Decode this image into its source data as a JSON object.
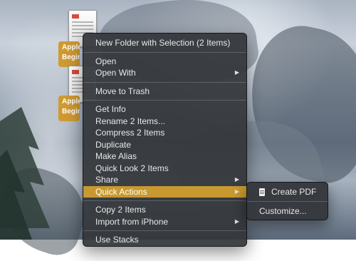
{
  "desktop": {
    "files": [
      {
        "label_line1": "Apple",
        "label_line2": "Begin"
      },
      {
        "label_line1": "Apple",
        "label_line2": "Begin"
      }
    ]
  },
  "context_menu": {
    "items": [
      {
        "label": "New Folder with Selection (2 Items)",
        "has_submenu": false
      },
      {
        "label": "Open",
        "has_submenu": false
      },
      {
        "label": "Open With",
        "has_submenu": true
      },
      {
        "label": "Move to Trash",
        "has_submenu": false
      },
      {
        "label": "Get Info",
        "has_submenu": false
      },
      {
        "label": "Rename 2 Items...",
        "has_submenu": false
      },
      {
        "label": "Compress 2 Items",
        "has_submenu": false
      },
      {
        "label": "Duplicate",
        "has_submenu": false
      },
      {
        "label": "Make Alias",
        "has_submenu": false
      },
      {
        "label": "Quick Look 2 Items",
        "has_submenu": false
      },
      {
        "label": "Share",
        "has_submenu": true
      },
      {
        "label": "Quick Actions",
        "has_submenu": true,
        "highlighted": true
      },
      {
        "label": "Copy 2 Items",
        "has_submenu": false
      },
      {
        "label": "Import from iPhone",
        "has_submenu": true
      },
      {
        "label": "Use Stacks",
        "has_submenu": false
      }
    ],
    "arrow_glyph": "▶",
    "highlight_color": "#c8992f"
  },
  "quick_actions_submenu": {
    "items": [
      {
        "label": "Create PDF",
        "icon": "pdf-document-icon"
      },
      {
        "label": "Customize..."
      }
    ]
  }
}
